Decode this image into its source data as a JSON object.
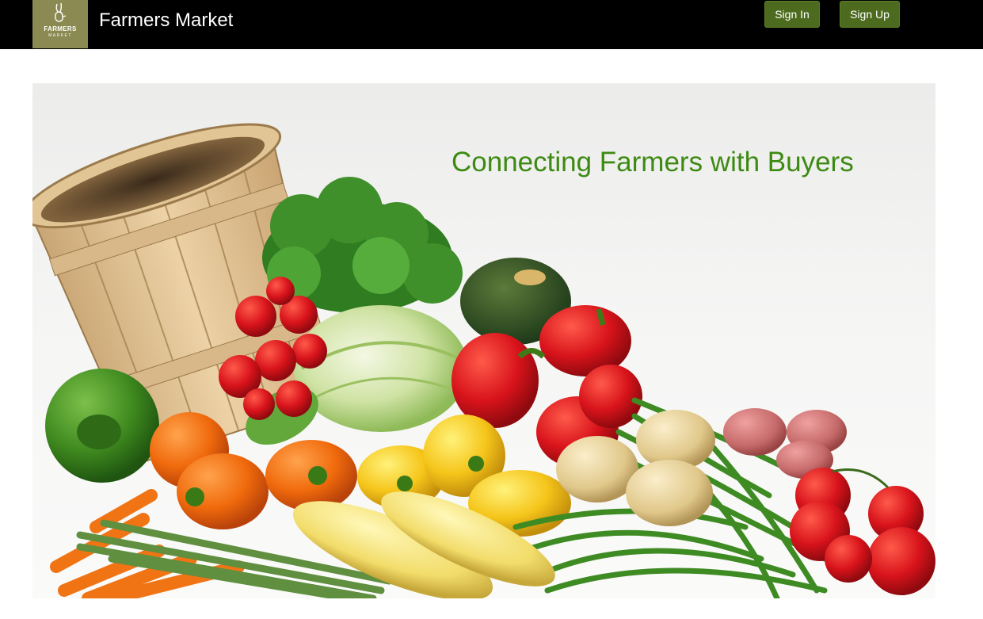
{
  "header": {
    "logo": {
      "word": "FARMERS",
      "sub": "MARKET",
      "icon": "rabbit-logo-icon"
    },
    "brand": "Farmers Market",
    "signin_label": "Sign In",
    "signup_label": "Sign Up"
  },
  "hero": {
    "title": "Connecting Farmers with Buyers",
    "image": "vegetable-basket-image"
  },
  "colors": {
    "topbar": "#000000",
    "button": "#4d6b1e",
    "logo_bg": "#8a8a52",
    "hero_title": "#3d8a12"
  }
}
